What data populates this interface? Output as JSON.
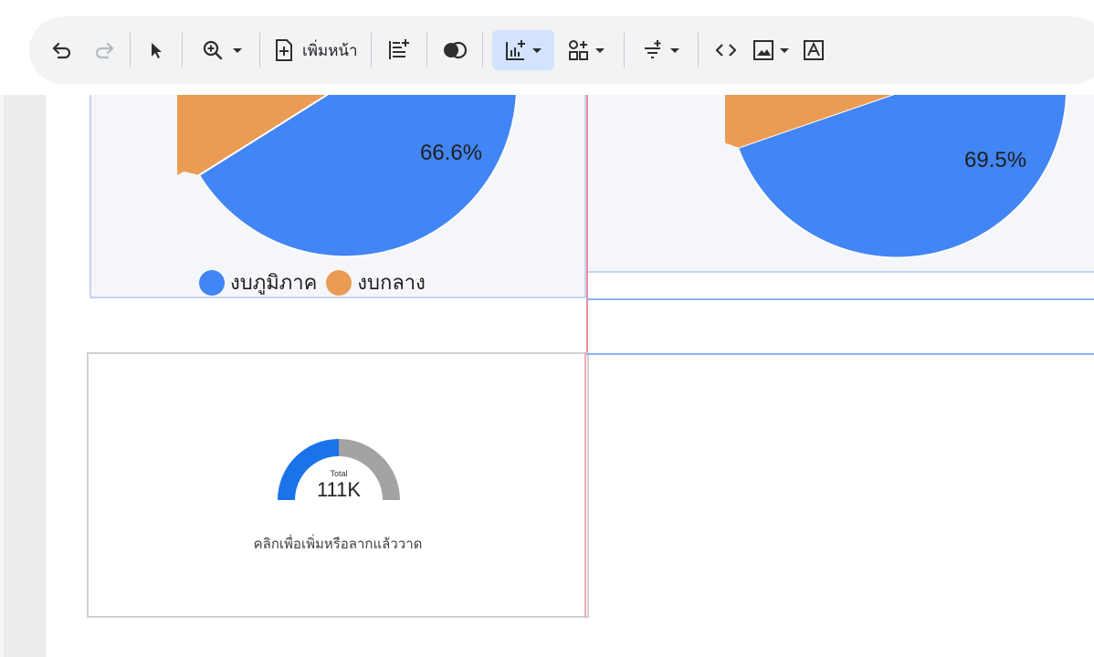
{
  "toolbar": {
    "undo_icon": "undo-icon",
    "redo_icon": "redo-icon",
    "select_icon": "cursor-icon",
    "zoom_icon": "zoom-in-icon",
    "add_page_label": "เพิ่มหน้า",
    "add_page_icon": "add-page-icon",
    "add_section_icon": "add-section-icon",
    "blend_icon": "blend-icon",
    "add_chart_icon": "add-chart-icon",
    "add_control_icon": "add-control-icon",
    "filter_icon": "filter-icon",
    "embed_icon": "code-icon",
    "image_icon": "image-icon",
    "text_icon": "text-icon"
  },
  "colors": {
    "pie_blue": "#4285f4",
    "pie_orange": "#eb9c54",
    "gauge_blue": "#1a73e8",
    "gauge_gray": "#a3a3a3"
  },
  "left_pie": {
    "label_percent": "66.6%",
    "legend": [
      {
        "label": "งบภูมิภาค",
        "color": "#4285f4"
      },
      {
        "label": "งบกลาง",
        "color": "#eb9c54"
      }
    ]
  },
  "right_pie": {
    "label_percent": "69.5%"
  },
  "gauge": {
    "total_label": "Total",
    "total_value": "111K",
    "fill_fraction": 0.5,
    "caption": "คลิกเพื่อเพิ่มหรือลากแล้ววาด"
  }
}
